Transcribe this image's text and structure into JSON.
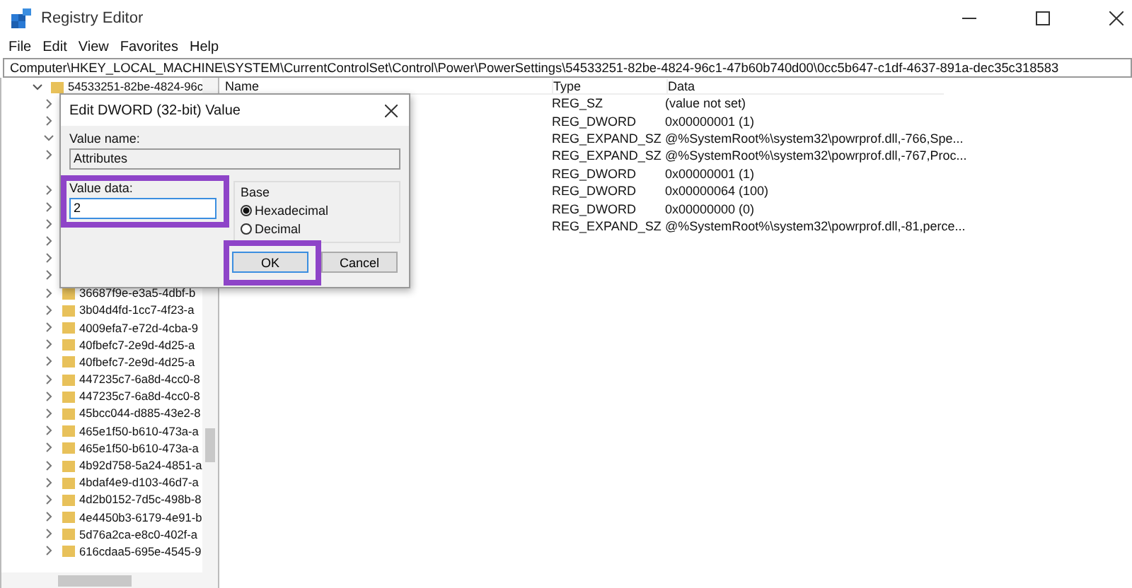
{
  "window": {
    "title": "Registry Editor"
  },
  "menu": [
    "File",
    "Edit",
    "View",
    "Favorites",
    "Help"
  ],
  "address": "Computer\\HKEY_LOCAL_MACHINE\\SYSTEM\\CurrentControlSet\\Control\\Power\\PowerSettings\\54533251-82be-4824-96c1-47b60b740d00\\0cc5b647-c1df-4637-891a-dec35c318583",
  "tree": {
    "items": [
      {
        "label": "54533251-82be-4824-96c",
        "expanded": true,
        "children": [
          {
            "expanded": false
          },
          {
            "expanded": false
          },
          {
            "expanded": true
          },
          {
            "expanded": false
          },
          {
            "expanded": false
          },
          {
            "expanded": false
          },
          {
            "expanded": false
          },
          {
            "expanded": false
          },
          {
            "expanded": false
          },
          {
            "expanded": false
          },
          {
            "label": "36687f9e-e3a5-4dbf-b",
            "expanded": false
          },
          {
            "label": "3b04d4fd-1cc7-4f23-a",
            "expanded": false
          },
          {
            "label": "4009efa7-e72d-4cba-9",
            "expanded": false
          },
          {
            "label": "40fbefc7-2e9d-4d25-a",
            "expanded": false
          },
          {
            "label": "40fbefc7-2e9d-4d25-a",
            "expanded": false
          },
          {
            "label": "447235c7-6a8d-4cc0-8",
            "expanded": false
          },
          {
            "label": "447235c7-6a8d-4cc0-8",
            "expanded": false
          },
          {
            "label": "45bcc044-d885-43e2-8",
            "expanded": false
          },
          {
            "label": "465e1f50-b610-473a-a",
            "expanded": false
          },
          {
            "label": "465e1f50-b610-473a-a",
            "expanded": false
          },
          {
            "label": "4b92d758-5a24-4851-a",
            "expanded": false
          },
          {
            "label": "4bdaf4e9-d103-46d7-a",
            "expanded": false
          },
          {
            "label": "4d2b0152-7d5c-498b-8",
            "expanded": false
          },
          {
            "label": "4e4450b3-6179-4e91-b",
            "expanded": false
          },
          {
            "label": "5d76a2ca-e8c0-402f-a",
            "expanded": false
          },
          {
            "label": "616cdaa5-695e-4545-9",
            "expanded": false
          }
        ]
      }
    ]
  },
  "table": {
    "columns": [
      "Name",
      "Type",
      "Data"
    ],
    "rows": [
      {
        "type": "REG_SZ",
        "data": "(value not set)"
      },
      {
        "type": "REG_DWORD",
        "data": "0x00000001 (1)"
      },
      {
        "type": "REG_EXPAND_SZ",
        "data": "@%SystemRoot%\\system32\\powrprof.dll,-766,Spe..."
      },
      {
        "type": "REG_EXPAND_SZ",
        "data": "@%SystemRoot%\\system32\\powrprof.dll,-767,Proc..."
      },
      {
        "type": "REG_DWORD",
        "data": "0x00000001 (1)"
      },
      {
        "type": "REG_DWORD",
        "data": "0x00000064 (100)"
      },
      {
        "type": "REG_DWORD",
        "data": "0x00000000 (0)"
      },
      {
        "type": "REG_EXPAND_SZ",
        "data": "@%SystemRoot%\\system32\\powrprof.dll,-81,perce..."
      }
    ]
  },
  "dialog": {
    "title": "Edit DWORD (32-bit) Value",
    "value_name_label": "Value name:",
    "value_name": "Attributes",
    "value_data_label": "Value data:",
    "value_data": "2",
    "base_label": "Base",
    "base_options": [
      {
        "label": "Hexadecimal",
        "selected": true
      },
      {
        "label": "Decimal",
        "selected": false
      }
    ],
    "buttons": [
      "OK",
      "Cancel"
    ]
  }
}
